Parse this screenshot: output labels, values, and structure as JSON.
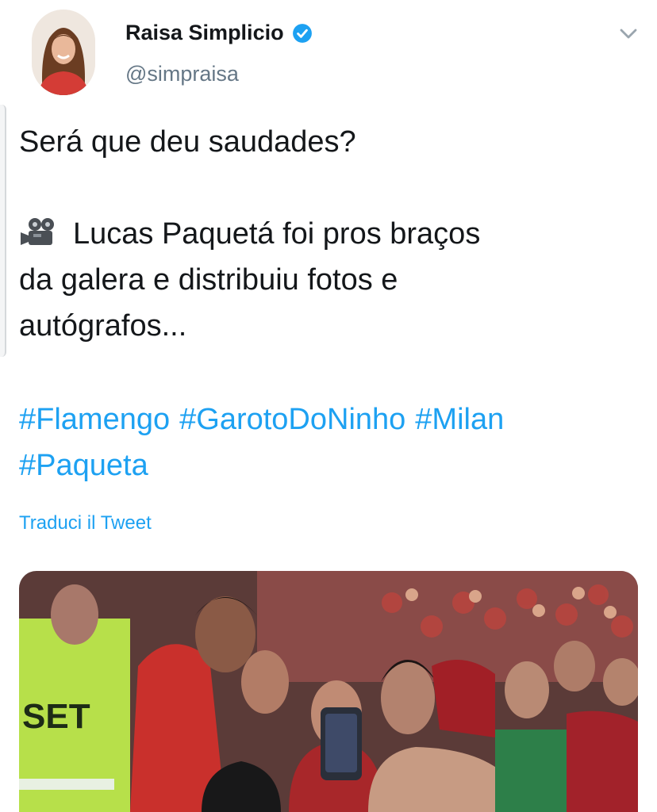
{
  "author": {
    "display_name": "Raisa Simplicio",
    "handle": "@simpraisa",
    "verified": true,
    "avatar_icon": "profile-photo"
  },
  "tweet": {
    "line1": "Será que deu saudades?",
    "emoji_icon": "movie-camera-icon",
    "line2": "Lucas Paquetá foi pros braços",
    "line3": "da galera e distribuiu fotos e",
    "line4": "autógrafos...",
    "hashtags": [
      "#Flamengo",
      "#GarotoDoNinho",
      "#Milan",
      "#Paqueta"
    ]
  },
  "translate_label": "Traduci il Tweet",
  "media": {
    "vest_text": "SET"
  },
  "colors": {
    "link": "#1da1f2",
    "text": "#14171a",
    "secondary": "#657786"
  }
}
